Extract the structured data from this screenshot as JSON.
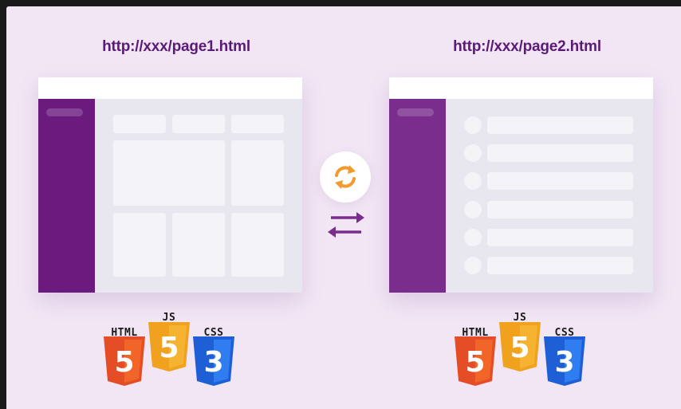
{
  "pages": [
    {
      "url": "http://xxx/page1.html",
      "sidebar_color": "#6b1a7e",
      "layout": "grid"
    },
    {
      "url": "http://xxx/page2.html",
      "sidebar_color": "#7b2d8e",
      "layout": "list"
    }
  ],
  "center": {
    "sync_icon": "refresh-icon",
    "swap_icon": "swap-arrows-icon",
    "sync_color": "#f29a2e",
    "arrow_color": "#7b2d8e"
  },
  "tech_logos": [
    {
      "label": "HTML",
      "digit": "5",
      "color": "#e44d26",
      "dark": "#c23b1a",
      "icon": "html5-icon"
    },
    {
      "label": "JS",
      "digit": "5",
      "color": "#f0a21e",
      "dark": "#d6881a",
      "icon": "js-icon"
    },
    {
      "label": "CSS",
      "digit": "3",
      "color": "#2965f1",
      "dark": "#1f4fc2",
      "icon": "css3-icon"
    }
  ]
}
